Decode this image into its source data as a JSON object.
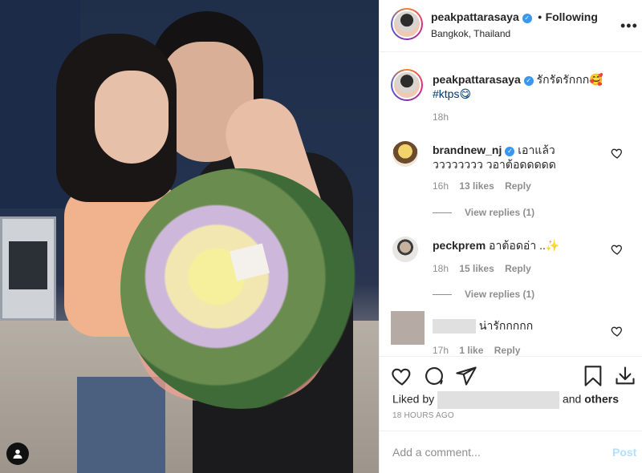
{
  "header": {
    "username": "peakpattarasaya",
    "separator": "•",
    "follow_status": "Following",
    "location": "Bangkok, Thailand",
    "more_icon": "more-horizontal-icon"
  },
  "caption": {
    "username": "peakpattarasaya",
    "text": "รักรัดรักกก🥰",
    "hashtag": "#ktps😋",
    "time": "18h"
  },
  "comments": [
    {
      "username": "brandnew_nj",
      "verified": true,
      "text": "เอาแล้ววววววววว วอาต้อดดดดด",
      "time": "16h",
      "likes": "13 likes",
      "reply": "Reply",
      "view_replies": "View replies (1)"
    },
    {
      "username": "peckprem",
      "verified": false,
      "text": "อาต้อดอ่า ..✨",
      "time": "18h",
      "likes": "15 likes",
      "reply": "Reply",
      "view_replies": "View replies (1)"
    },
    {
      "username": "",
      "verified": false,
      "text": "น่ารักกกกก",
      "time": "17h",
      "likes": "1 like",
      "reply": "Reply"
    }
  ],
  "actions": {
    "like_icon": "heart-icon",
    "comment_icon": "comment-icon",
    "share_icon": "send-icon",
    "save_icon": "bookmark-icon",
    "download_icon": "download-icon"
  },
  "likes": {
    "prefix": "Liked by",
    "suffix": "and",
    "others": "others"
  },
  "timestamp": "18 hours ago",
  "add_comment": {
    "placeholder": "Add a comment...",
    "post_label": "Post"
  },
  "colors": {
    "verified": "#3897f0",
    "hashtag": "#00376b",
    "muted": "#8e8e8e",
    "post_disabled": "#b2dffc"
  }
}
